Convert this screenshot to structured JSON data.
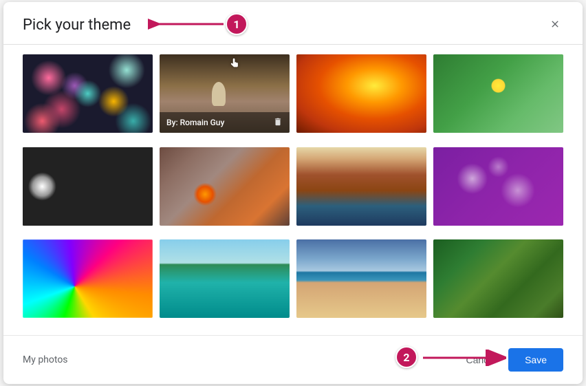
{
  "dialog": {
    "title": "Pick your theme",
    "close_aria": "Close"
  },
  "themes": [
    {
      "id": "bokeh",
      "alt": "Colorful bokeh lights"
    },
    {
      "id": "chess",
      "alt": "Chess pieces",
      "hovered": true,
      "attribution": "By: Romain Guy"
    },
    {
      "id": "canyon",
      "alt": "Antelope canyon"
    },
    {
      "id": "caterpillar",
      "alt": "Caterpillar on green leaf"
    },
    {
      "id": "tubes",
      "alt": "Metallic tubes"
    },
    {
      "id": "leaves",
      "alt": "Autumn leaves"
    },
    {
      "id": "horseshoe",
      "alt": "Horseshoe bend canyon"
    },
    {
      "id": "jellyfish",
      "alt": "Purple jellyfish"
    },
    {
      "id": "rainbow",
      "alt": "Rainbow water surface"
    },
    {
      "id": "lake",
      "alt": "Tropical lake with trees"
    },
    {
      "id": "beach",
      "alt": "Beach with person"
    },
    {
      "id": "forest",
      "alt": "Green forest path"
    }
  ],
  "footer": {
    "my_photos": "My photos",
    "cancel": "Cancel",
    "save": "Save"
  },
  "annotations": {
    "one": "1",
    "two": "2"
  }
}
